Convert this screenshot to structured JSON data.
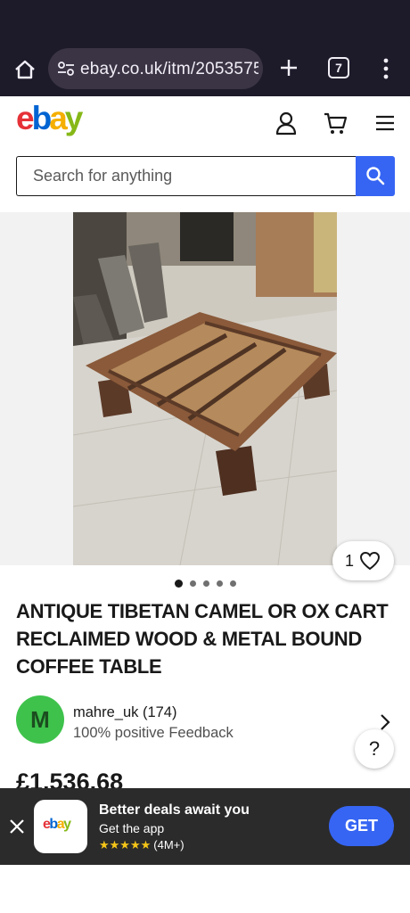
{
  "browser": {
    "url": "ebay.co.uk/itm/2053575",
    "tab_count": "7"
  },
  "header": {
    "logo_letters": [
      "e",
      "b",
      "a",
      "y"
    ],
    "search_placeholder": "Search for anything"
  },
  "gallery": {
    "watch_count": "1",
    "image_count": 5,
    "active_index": 0
  },
  "listing": {
    "title": "ANTIQUE TIBETAN CAMEL OR OX CART RECLAIMED WOOD & METAL BOUND COFFEE TABLE",
    "price": "£1,536.68"
  },
  "seller": {
    "avatar_letter": "M",
    "name": "mahre_uk (174)",
    "feedback": "100% positive Feedback"
  },
  "help": {
    "label": "?"
  },
  "app_banner": {
    "title": "Better deals await you",
    "subtitle": "Get the app",
    "stars": "★★★★★",
    "rating_count": "(4M+)",
    "get_label": "GET",
    "icon_text": "ebay"
  },
  "colors": {
    "ebay_red": "#e53238",
    "ebay_blue": "#0064d2",
    "ebay_yellow": "#f5af02",
    "ebay_green": "#86b817",
    "accent_blue": "#3665f3",
    "avatar_green": "#3ec24b"
  }
}
